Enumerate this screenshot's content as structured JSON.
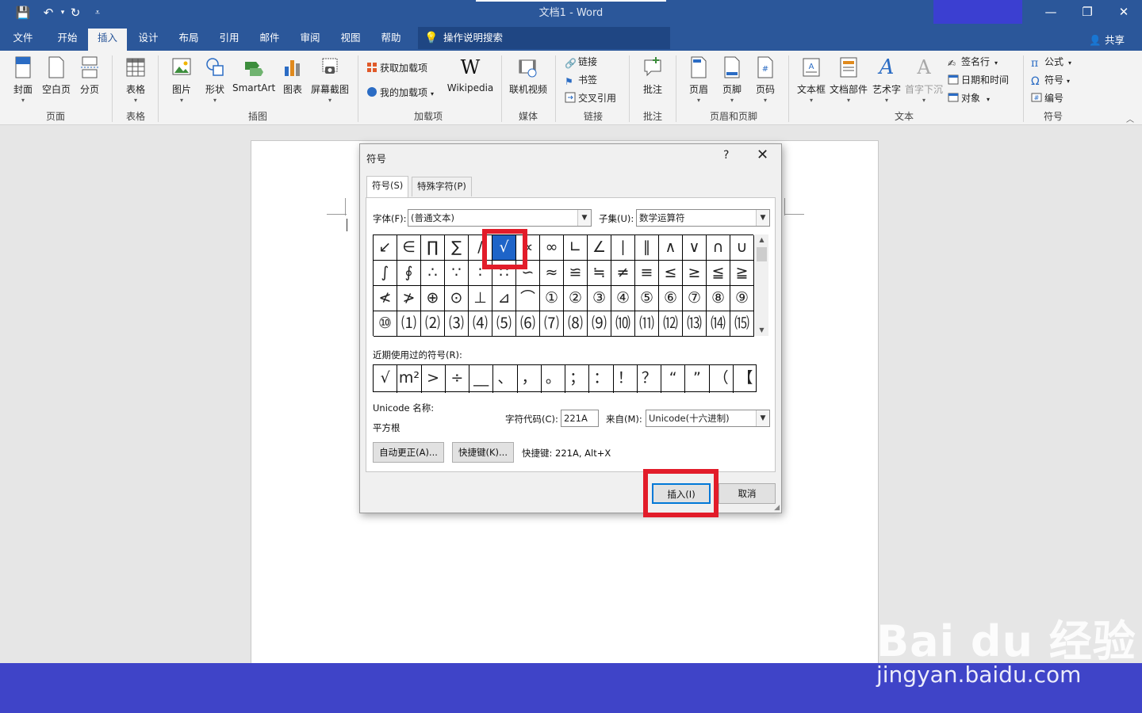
{
  "window": {
    "doc_title": "文档1  -  Word",
    "min": "—",
    "restore": "❐",
    "close": "✕"
  },
  "quick_access": {
    "save": "💾",
    "undo": "↶",
    "redo": "↻",
    "customize": "⩡"
  },
  "tabs": [
    "文件",
    "开始",
    "插入",
    "设计",
    "布局",
    "引用",
    "邮件",
    "审阅",
    "视图",
    "帮助"
  ],
  "active_tab": "插入",
  "tell_me": "操作说明搜索",
  "share": "共享",
  "ribbon": {
    "pages": {
      "cover": "封面",
      "blank": "空白页",
      "break": "分页",
      "group": "页面"
    },
    "tables": {
      "table": "表格",
      "group": "表格"
    },
    "illustrations": {
      "picture": "图片",
      "shapes": "形状",
      "smartart": "SmartArt",
      "chart": "图表",
      "screenshot": "屏幕截图",
      "group": "插图"
    },
    "addins": {
      "get": "获取加载项",
      "mine": "我的加载项",
      "wikipedia": "Wikipedia",
      "group": "加载项"
    },
    "media": {
      "video": "联机视频",
      "group": "媒体"
    },
    "links": {
      "link": "链接",
      "bookmark": "书签",
      "crossref": "交叉引用",
      "group": "链接"
    },
    "comments": {
      "comment": "批注",
      "group": "批注"
    },
    "headerfooter": {
      "header": "页眉",
      "footer": "页脚",
      "pagenum": "页码",
      "group": "页眉和页脚"
    },
    "text": {
      "textbox": "文本框",
      "quickparts": "文档部件",
      "wordart": "艺术字",
      "dropcap": "首字下沉",
      "signature": "签名行",
      "datetime": "日期和时间",
      "object": "对象",
      "group": "文本"
    },
    "symbols": {
      "equation": "公式",
      "symbol": "符号",
      "number": "编号",
      "group": "符号"
    }
  },
  "dialog": {
    "title": "符号",
    "help": "?",
    "close": "✕",
    "tab_symbols": "符号(S)",
    "tab_special": "特殊字符(P)",
    "font_label": "字体(F):",
    "font_value": "(普通文本)",
    "subset_label": "子集(U):",
    "subset_value": "数学运算符",
    "symbols": [
      "↙",
      "∈",
      "∏",
      "∑",
      "∕",
      "√",
      "∝",
      "∞",
      "∟",
      "∠",
      "∣",
      "∥",
      "∧",
      "∨",
      "∩",
      "∪",
      "∫",
      "∮",
      "∴",
      "∵",
      "∶",
      "∷",
      "∽",
      "≈",
      "≌",
      "≒",
      "≠",
      "≡",
      "≤",
      "≥",
      "≦",
      "≧",
      "≮",
      "≯",
      "⊕",
      "⊙",
      "⊥",
      "⊿",
      "⌒",
      "①",
      "②",
      "③",
      "④",
      "⑤",
      "⑥",
      "⑦",
      "⑧",
      "⑨",
      "⑩",
      "⑴",
      "⑵",
      "⑶",
      "⑷",
      "⑸",
      "⑹",
      "⑺",
      "⑻",
      "⑼",
      "⑽",
      "⑾",
      "⑿",
      "⒀",
      "⒁",
      "⒂"
    ],
    "selected_index": 5,
    "recent_label": "近期使用过的符号(R):",
    "recent": [
      "√",
      "m²",
      ">",
      "÷",
      "__",
      "、",
      "，",
      "。",
      "；",
      "：",
      "！",
      "？",
      "“",
      "”",
      "（",
      "【"
    ],
    "unicode_name_label": "Unicode 名称:",
    "unicode_name": "平方根",
    "charcode_label": "字符代码(C):",
    "charcode": "221A",
    "from_label": "来自(M):",
    "from_value": "Unicode(十六进制)",
    "autocorrect": "自动更正(A)...",
    "shortcut_key": "快捷键(K)...",
    "shortcut_text": "快捷键: 221A, Alt+X",
    "insert": "插入(I)",
    "cancel": "取消"
  },
  "watermark": {
    "logo": "Bai du 经验",
    "url": "jingyan.baidu.com"
  },
  "colors": {
    "word_blue": "#2b579a",
    "ribbon_bg": "#f3f3f3",
    "highlight_red": "#e21c2a",
    "selection_blue": "#1e64c8"
  }
}
